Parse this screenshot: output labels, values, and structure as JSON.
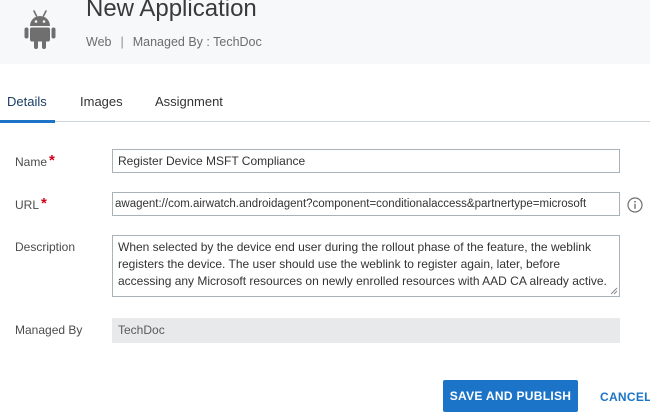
{
  "app": {
    "title": "New Application",
    "platform": "Web",
    "separator": "|",
    "managed_by_text": "Managed By : TechDoc",
    "icon": "android-icon"
  },
  "tabs": [
    {
      "label": "Details",
      "active": true
    },
    {
      "label": "Images",
      "active": false
    },
    {
      "label": "Assignment",
      "active": false
    }
  ],
  "form": {
    "name": {
      "label": "Name",
      "required_mark": "*",
      "value": "Register Device MSFT Compliance"
    },
    "url": {
      "label": "URL",
      "required_mark": "*",
      "value": "awagent://com.airwatch.androidagent?component=conditionalaccess&partnertype=microsoft",
      "info_icon": "info-icon"
    },
    "description": {
      "label": "Description",
      "value": "When selected by the device end user during the rollout phase of the feature, the weblink registers the device. The user should use the weblink to register again, later, before accessing any Microsoft resources on newly enrolled resources with AAD CA already active."
    },
    "managed_by": {
      "label": "Managed By",
      "value": "TechDoc"
    }
  },
  "actions": {
    "save_publish": "SAVE AND PUBLISH",
    "cancel": "CANCEL"
  },
  "colors": {
    "accent": "#1c74c9",
    "required": "#d0021b",
    "header_bg": "#f7f8f9",
    "readonly_bg": "#e8e9ea"
  }
}
